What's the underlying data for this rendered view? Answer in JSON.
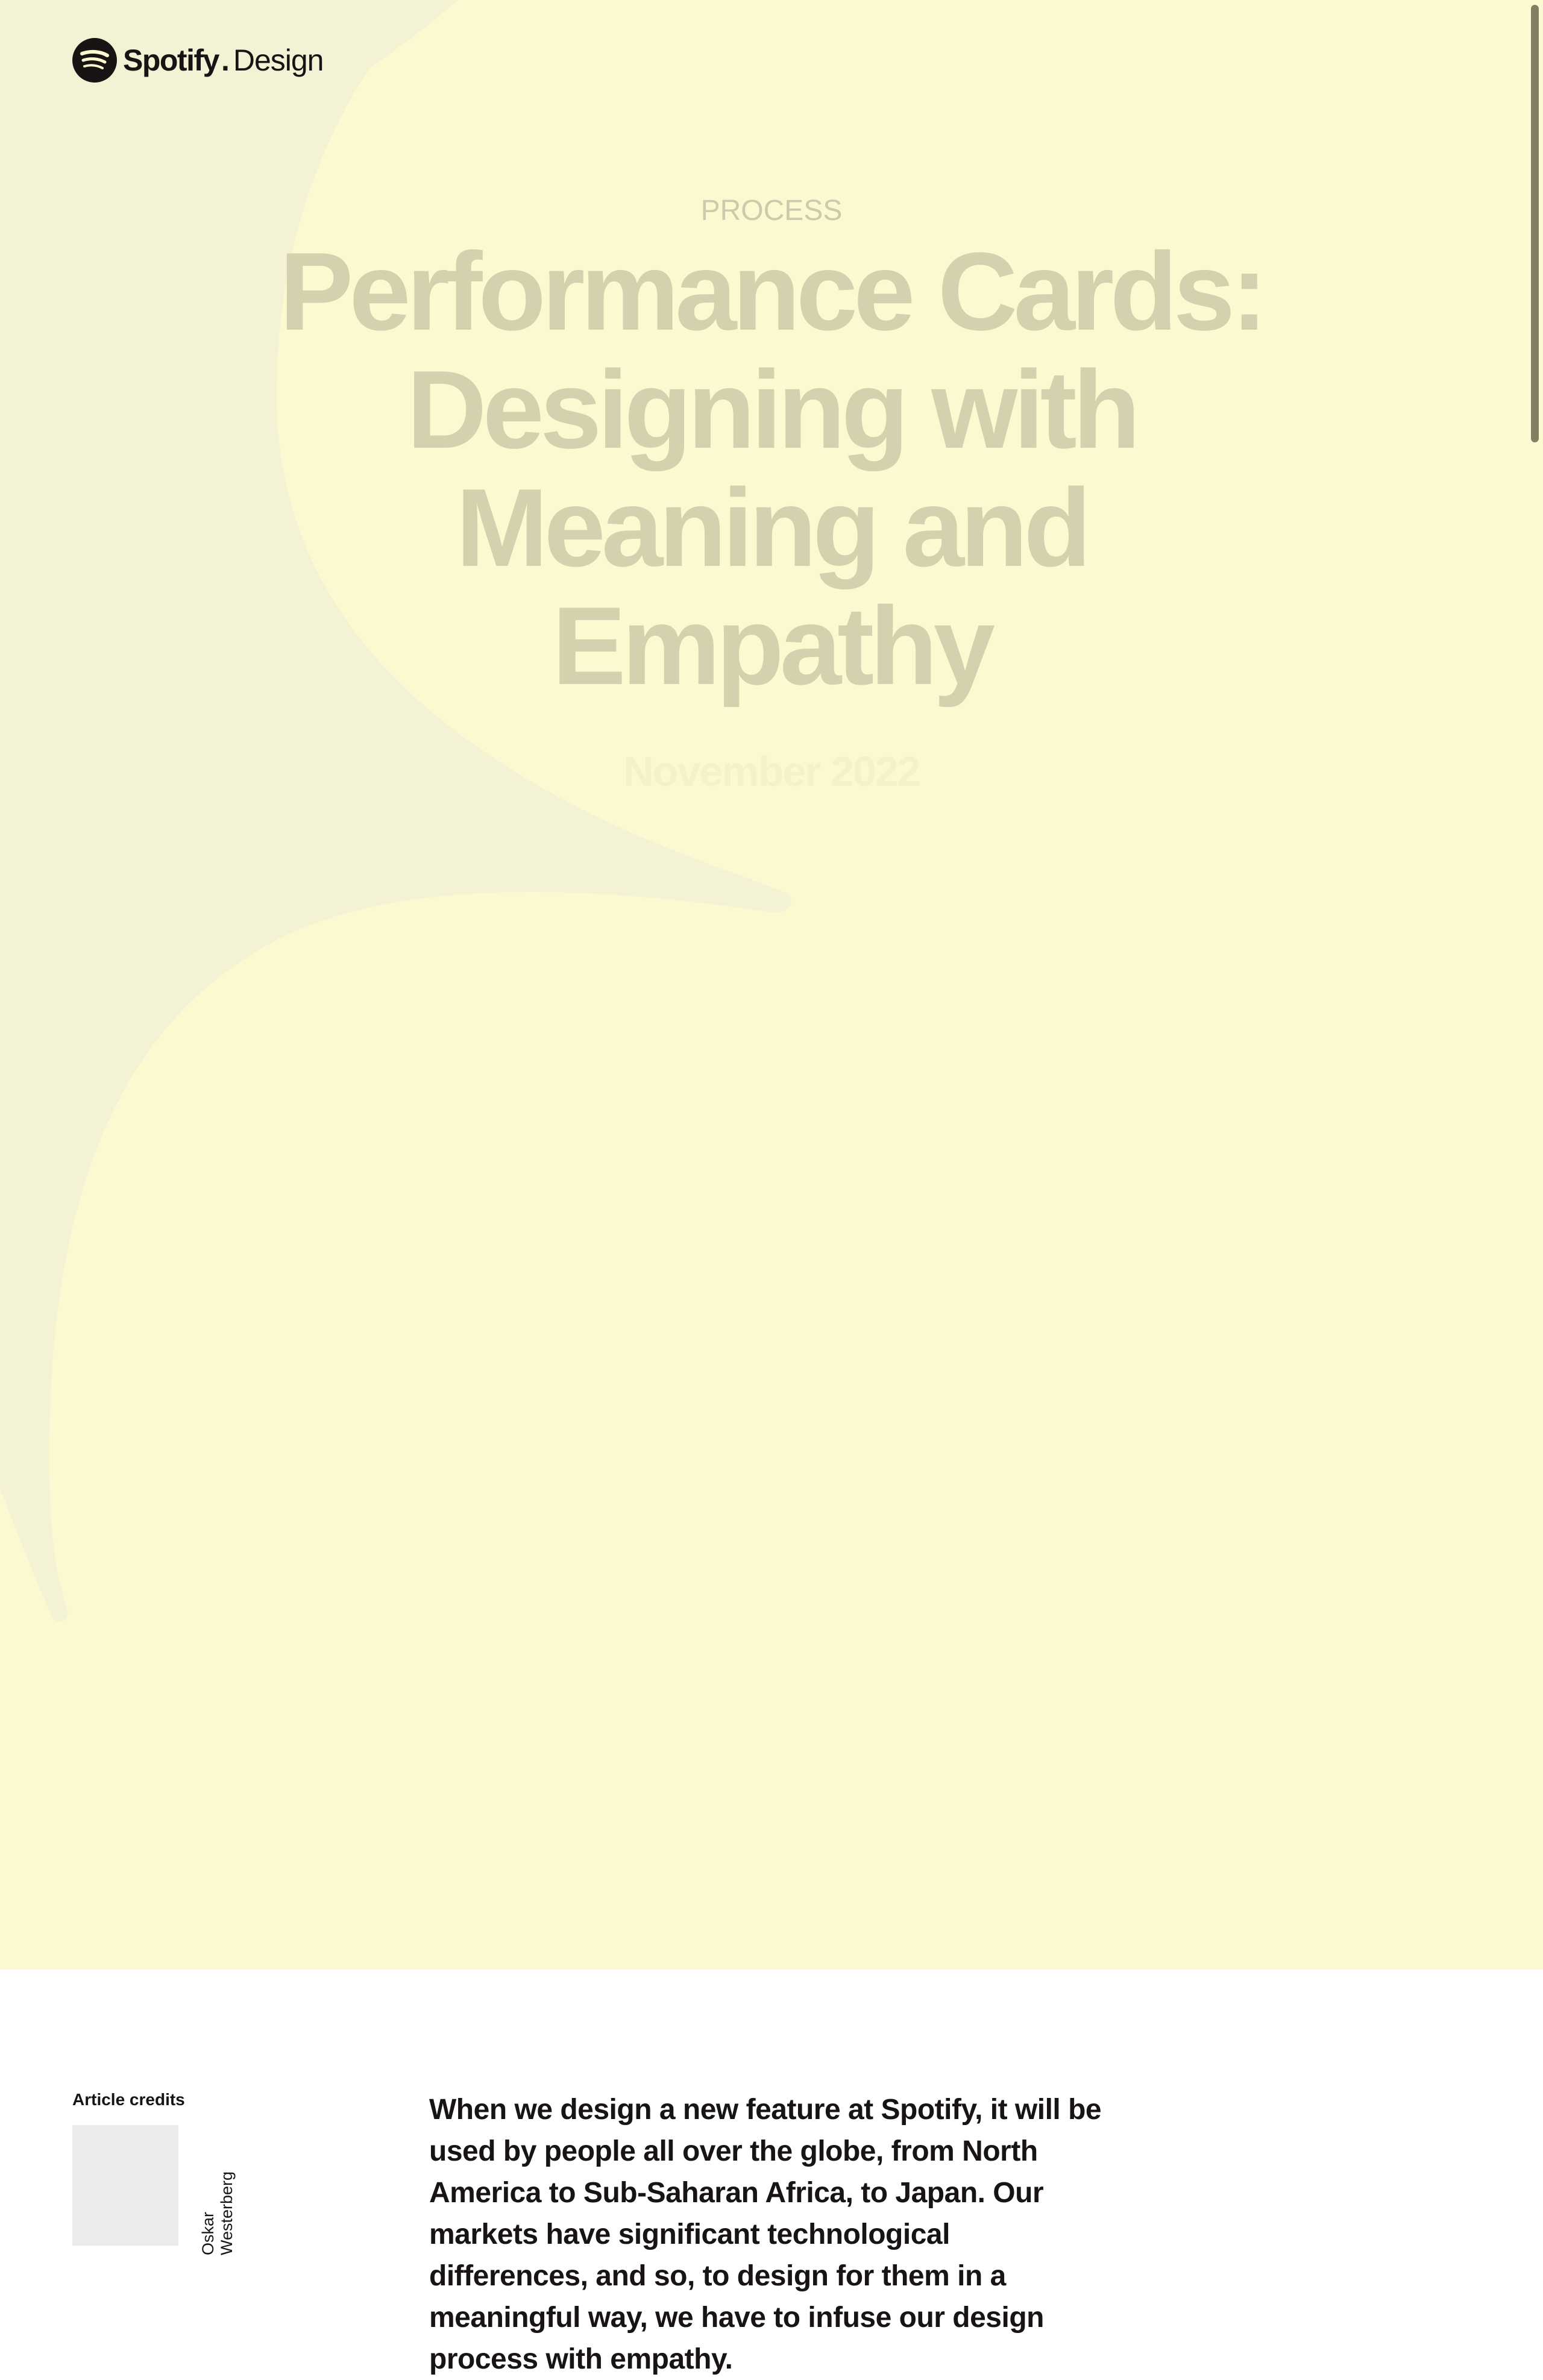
{
  "brand": {
    "name": "Spotify",
    "dot": ".",
    "suffix": "Design"
  },
  "hero": {
    "category": "PROCESS",
    "title": "Performance Cards: Designing with Meaning and Empathy",
    "date": "November 2022",
    "background_color": "#fcf9d0",
    "shape_color": "#f3f2d4",
    "text_color": "#d5d1ae"
  },
  "credits": {
    "label": "Article credits",
    "author": "Oskar Westerberg"
  },
  "article": {
    "intro": "When we design a new feature at Spotify, it will be used by people all over the globe, from North America to Sub-Saharan Africa, to Japan. Our markets have significant technological differences, and so, to design for them in a meaningful way, we have to infuse our design process with empathy."
  },
  "icons": {
    "logo": "spotify-logo-icon"
  }
}
